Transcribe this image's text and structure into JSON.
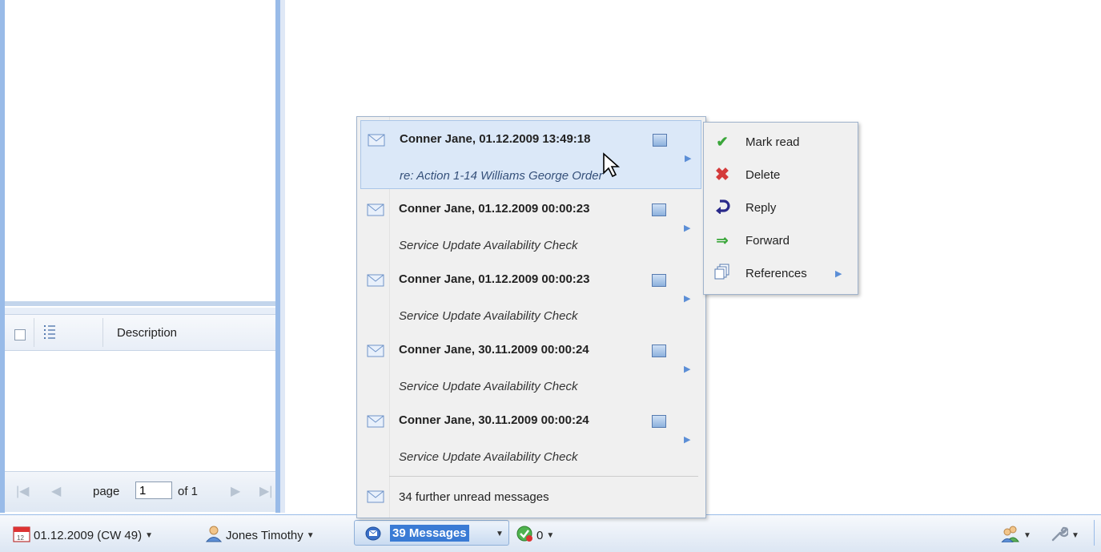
{
  "left_panel": {
    "grid": {
      "column_description": "Description"
    },
    "pager": {
      "page_label": "page",
      "page_value": "1",
      "of_label": "of 1"
    }
  },
  "taskbar": {
    "date": "01.12.2009 (CW 49)",
    "user": "Jones Timothy",
    "messages": "39 Messages",
    "tasks_count": "0"
  },
  "message_menu": {
    "items": [
      {
        "title": "Conner Jane, 01.12.2009 13:49:18",
        "subject": "re: Action 1-14 Williams George Order"
      },
      {
        "title": "Conner Jane, 01.12.2009 00:00:23",
        "subject": "Service Update Availability Check"
      },
      {
        "title": "Conner Jane, 01.12.2009 00:00:23",
        "subject": "Service Update Availability Check"
      },
      {
        "title": "Conner Jane, 30.11.2009 00:00:24",
        "subject": "Service Update Availability Check"
      },
      {
        "title": "Conner Jane, 30.11.2009 00:00:24",
        "subject": "Service Update Availability Check"
      }
    ],
    "further": "34 further unread messages"
  },
  "context_menu": {
    "items": [
      {
        "label": "Mark read",
        "icon": "checkmark-icon",
        "color": "#3aa63a"
      },
      {
        "label": "Delete",
        "icon": "delete-x-icon",
        "color": "#d43a3a"
      },
      {
        "label": "Reply",
        "icon": "reply-arrow-icon",
        "color": "#2a2a8a"
      },
      {
        "label": "Forward",
        "icon": "forward-arrow-icon",
        "color": "#3aa63a"
      },
      {
        "label": "References",
        "icon": "references-icon",
        "color": "#557ab0"
      }
    ]
  }
}
